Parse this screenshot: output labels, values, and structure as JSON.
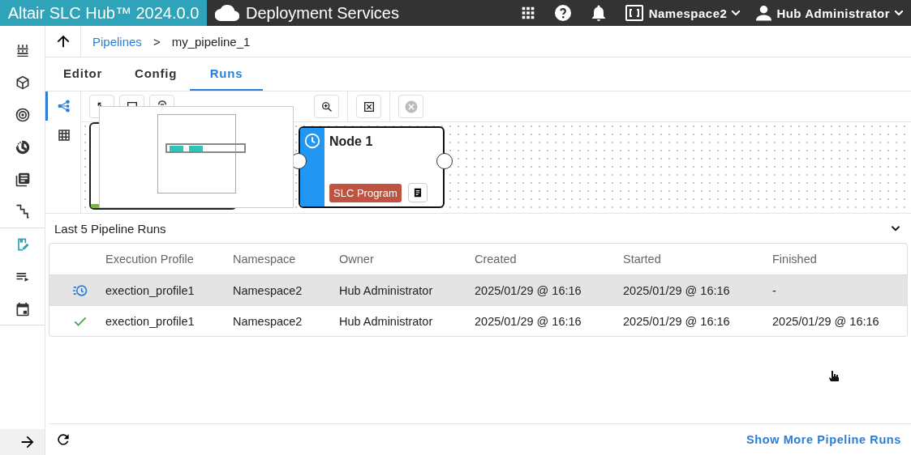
{
  "header": {
    "brand": "Altair SLC Hub™ 2024.0.0",
    "section": "Deployment Services",
    "namespace": "Namespace2",
    "user": "Hub Administrator"
  },
  "sidebar": {
    "items": [
      {
        "kind": "stack",
        "selected": false
      },
      {
        "kind": "cube",
        "selected": false
      },
      {
        "kind": "target",
        "selected": false
      },
      {
        "kind": "history",
        "selected": false
      },
      {
        "kind": "library",
        "selected": false
      },
      {
        "kind": "steps",
        "selected": false
      },
      {
        "kind": "pipeline",
        "selected": true
      },
      {
        "kind": "queue",
        "selected": false
      },
      {
        "kind": "calendar",
        "selected": false
      }
    ]
  },
  "breadcrumb": {
    "link": "Pipelines",
    "separator": ">",
    "current": "my_pipeline_1"
  },
  "tabs": [
    {
      "label": "Editor",
      "selected": false
    },
    {
      "label": "Config",
      "selected": false
    },
    {
      "label": "Runs",
      "selected": true
    }
  ],
  "view_toggle": [
    {
      "kind": "graph",
      "selected": true
    },
    {
      "kind": "table",
      "selected": false
    }
  ],
  "node": {
    "title": "Node 1",
    "badge": "SLC Program"
  },
  "runs": {
    "title": "Last 5 Pipeline Runs",
    "columns": [
      "Execution Profile",
      "Namespace",
      "Owner",
      "Created",
      "Started",
      "Finished"
    ],
    "rows": [
      {
        "kind": "running",
        "selected": true,
        "cells": [
          "exection_profile1",
          "Namespace2",
          "Hub Administrator",
          "2025/01/29 @ 16:16",
          "2025/01/29 @ 16:16",
          "-"
        ]
      },
      {
        "kind": "succeeded",
        "selected": false,
        "cells": [
          "exection_profile1",
          "Namespace2",
          "Hub Administrator",
          "2025/01/29 @ 16:16",
          "2025/01/29 @ 16:16",
          "2025/01/29 @ 16:16"
        ]
      }
    ]
  },
  "footer": {
    "link": "Show More Pipeline Runs"
  }
}
